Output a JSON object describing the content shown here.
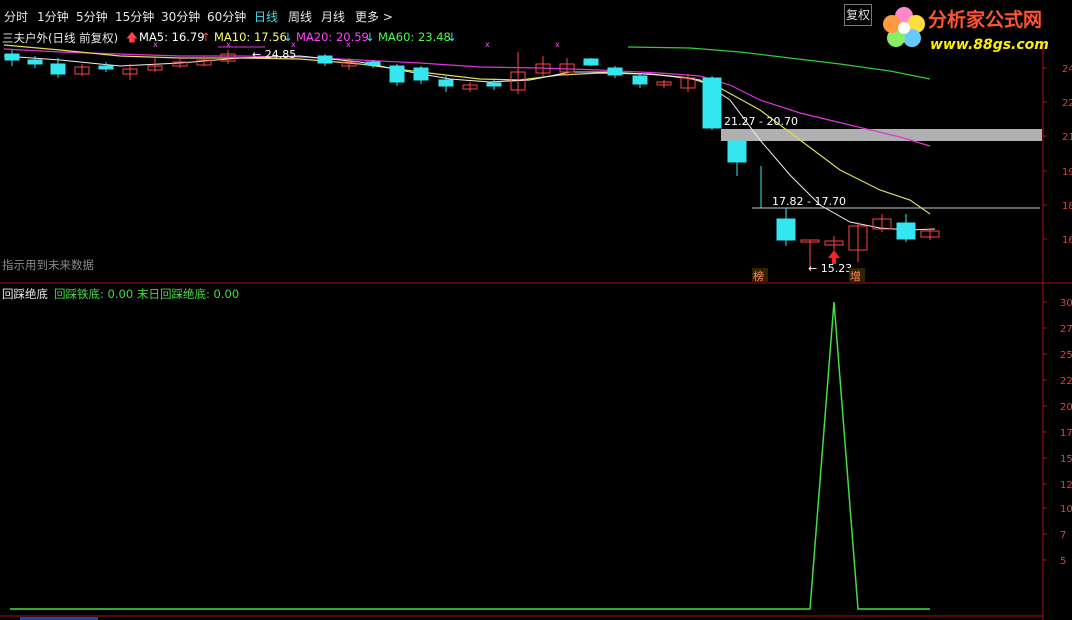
{
  "toolbar": {
    "items": [
      "分时",
      "1分钟",
      "5分钟",
      "15分钟",
      "30分钟",
      "60分钟",
      "日线",
      "周线",
      "月线",
      "更多 >"
    ],
    "active": "日线",
    "adjust_label": "复权"
  },
  "logo": {
    "name": "分析家公式网",
    "url": "www.88gs.com"
  },
  "main_panel": {
    "stock_title": "三夫户外(日线 前复权)",
    "ma": [
      {
        "label": "MA5: 16.79",
        "color": "#ffffff",
        "arrow": "up"
      },
      {
        "label": "MA10: 17.56",
        "color": "#ffff66",
        "arrow": "down"
      },
      {
        "label": "MA20: 20.59",
        "color": "#ff44ff",
        "arrow": "down"
      },
      {
        "label": "MA60: 23.48",
        "color": "#44ff44",
        "arrow": "down"
      }
    ],
    "high_marker": "24.85",
    "low_marker": "15.23",
    "gap_label_1": "21.27 - 20.70",
    "gap_label_2": "17.82 - 17.70",
    "note_text": "指示用到未来数据",
    "tag_1": "榜",
    "tag_2": "增",
    "y_ticks": [
      "24",
      "22",
      "21",
      "19",
      "18",
      "16"
    ]
  },
  "sub_panel": {
    "title": "回踩绝底",
    "value_1": "回踩铁底: 0.00",
    "value_2": "末日回踩绝底: 0.00",
    "y_ticks": [
      "30",
      "27",
      "25",
      "22",
      "20",
      "17",
      "15",
      "12",
      "10",
      "7",
      "5"
    ]
  },
  "colors": {
    "up": "#ff4444",
    "down": "#33e6f0",
    "line_green": "#44dd44",
    "axis": "#aa1111"
  }
}
